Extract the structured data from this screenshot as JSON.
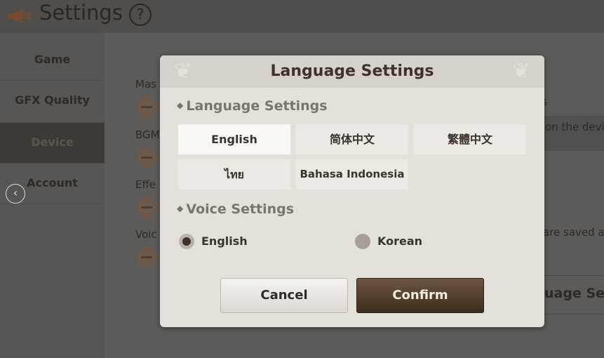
{
  "header": {
    "title": "Settings",
    "help_icon": "?"
  },
  "sidebar": {
    "items": [
      {
        "label": "Game"
      },
      {
        "label": "GFX Quality"
      },
      {
        "label": "Device",
        "active": true
      },
      {
        "label": "Account"
      }
    ]
  },
  "content": {
    "labels": [
      "Mas",
      "BGM",
      "Effe",
      "Voic"
    ],
    "right_texts": [
      "s",
      "on the devic",
      "are saved a",
      "uage Sett"
    ]
  },
  "modal": {
    "title": "Language Settings",
    "language_section": "Language Settings",
    "languages": [
      {
        "label": "English",
        "selected": true
      },
      {
        "label": "简体中文"
      },
      {
        "label": "繁體中文"
      },
      {
        "label": "ไทย"
      },
      {
        "label": "Bahasa Indonesia"
      }
    ],
    "voice_section": "Voice Settings",
    "voices": [
      {
        "label": "English",
        "selected": true
      },
      {
        "label": "Korean"
      }
    ],
    "cancel": "Cancel",
    "confirm": "Confirm"
  },
  "colors": {
    "accent": "#3d2c1c",
    "modal_bg": "#e4e1db"
  }
}
